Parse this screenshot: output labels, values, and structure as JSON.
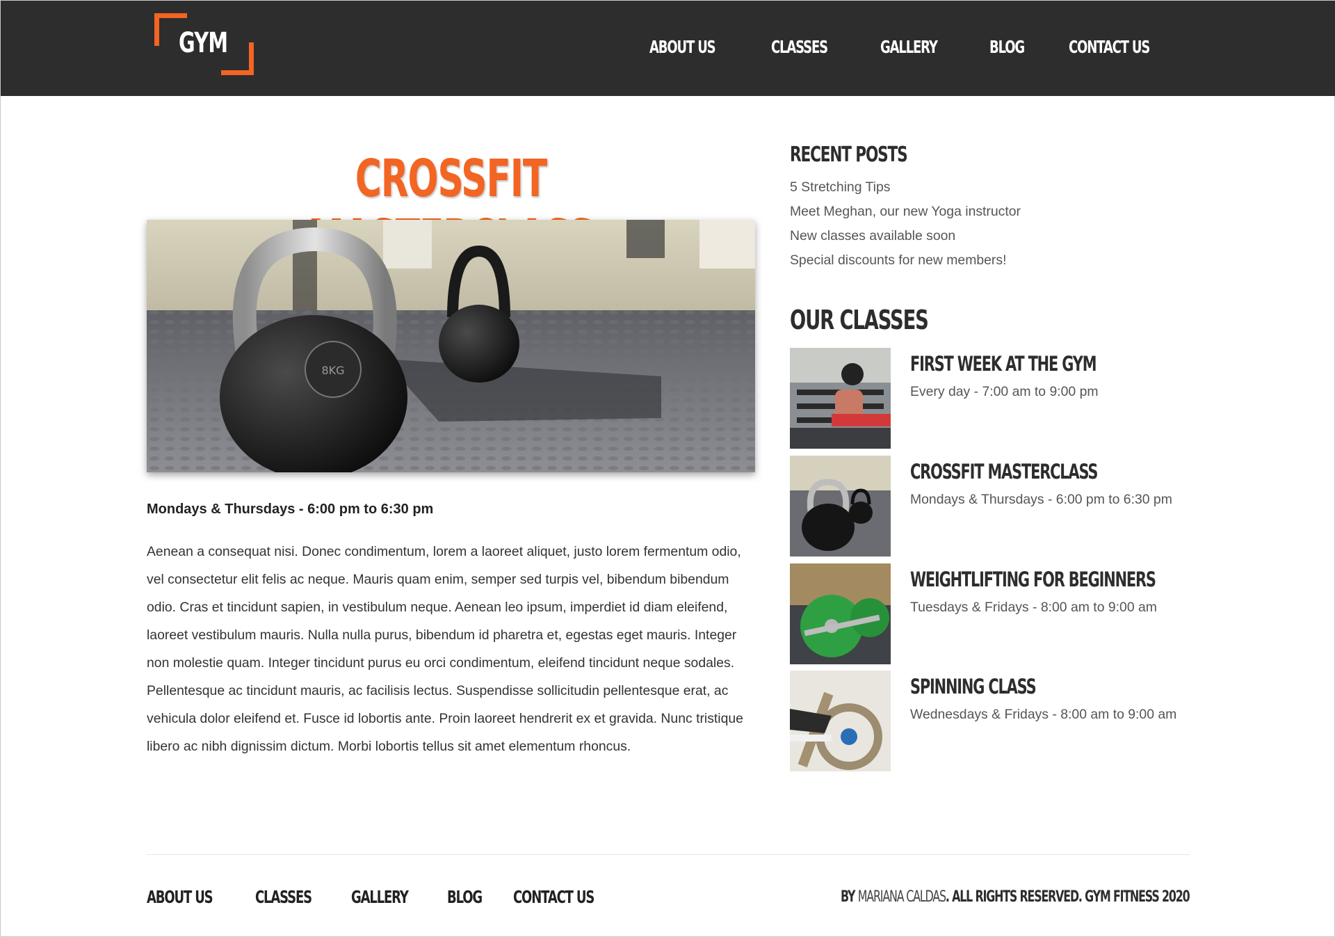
{
  "brand": {
    "logo_text": "GYM",
    "accent": "#f26522",
    "header_bg": "#2d2d2d"
  },
  "nav": {
    "items": [
      "ABOUT US",
      "CLASSES",
      "GALLERY",
      "BLOG",
      "CONTACT US"
    ]
  },
  "main": {
    "title": "CROSSFIT MASTERCLASS",
    "hero_image": "kettlebell-gym-floor-photo",
    "schedule": "Mondays & Thursdays - 6:00 pm to 6:30 pm",
    "body": "Aenean a consequat nisi. Donec condimentum, lorem a laoreet aliquet, justo lorem fermentum odio, vel consectetur elit felis ac neque. Mauris quam enim, semper sed turpis vel, bibendum bibendum odio. Cras et tincidunt sapien, in vestibulum neque. Aenean leo ipsum, imperdiet id diam eleifend, laoreet vestibulum mauris. Nulla nulla purus, bibendum id pharetra et, egestas eget mauris. Integer non molestie quam. Integer tincidunt purus eu orci condimentum, eleifend tincidunt neque sodales. Pellentesque ac tincidunt mauris, ac facilisis lectus. Suspendisse sollicitudin pellentesque erat, ac vehicula dolor eleifend et. Fusce id lobortis ante. Proin laoreet hendrerit ex et gravida. Nunc tristique libero ac nibh dignissim dictum. Morbi lobortis tellus sit amet elementum rhoncus."
  },
  "sidebar": {
    "recent_heading": "RECENT POSTS",
    "recent_posts": [
      "5 Stretching Tips",
      "Meet Meghan, our new Yoga instructor",
      "New classes available soon",
      "Special discounts for new members!"
    ],
    "classes_heading": "OUR CLASSES",
    "classes": [
      {
        "name": "FIRST WEEK AT THE GYM",
        "time": "Every day - 7:00 am to 9:00 pm",
        "thumb": "dumbbell-bench-photo"
      },
      {
        "name": "CROSSFIT MASTERCLASS",
        "time": "Mondays & Thursdays - 6:00 pm to 6:30 pm",
        "thumb": "kettlebell-photo"
      },
      {
        "name": "WEIGHTLIFTING FOR BEGINNERS",
        "time": "Tuesdays & Fridays - 8:00 am to 9:00 am",
        "thumb": "barbell-plates-photo"
      },
      {
        "name": "SPINNING CLASS",
        "time": "Wednesdays & Fridays - 8:00 am to 9:00 am",
        "thumb": "spinning-bike-photo"
      }
    ]
  },
  "footer": {
    "nav": [
      "ABOUT US",
      "CLASSES",
      "GALLERY",
      "BLOG",
      "CONTACT US"
    ],
    "copyright_prefix": "BY ",
    "author": "MARIANA CALDAS",
    "copyright_suffix": ". ALL RIGHTS RESERVED. GYM FITNESS 2020"
  }
}
